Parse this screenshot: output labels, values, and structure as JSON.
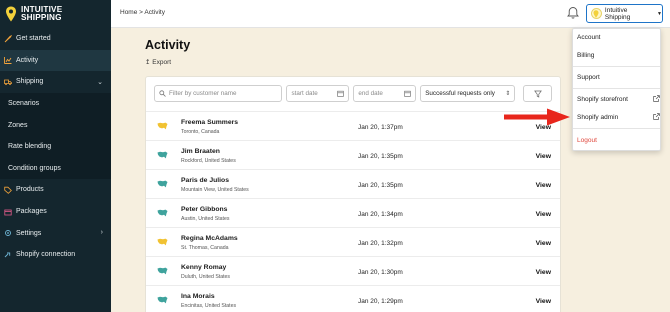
{
  "sidebar": {
    "brand_line1": "INTUITIVE",
    "brand_line2": "SHIPPING",
    "items": [
      {
        "label": "Get started"
      },
      {
        "label": "Activity"
      },
      {
        "label": "Shipping"
      },
      {
        "label": "Scenarios"
      },
      {
        "label": "Zones"
      },
      {
        "label": "Rate blending"
      },
      {
        "label": "Condition groups"
      },
      {
        "label": "Products"
      },
      {
        "label": "Packages"
      },
      {
        "label": "Settings"
      },
      {
        "label": "Shopify connection"
      }
    ]
  },
  "header": {
    "breadcrumb": "Home > Activity",
    "account_label": "Intuitive Shipping"
  },
  "page": {
    "title": "Activity",
    "export_label": "Export"
  },
  "filters": {
    "search_placeholder": "Filter by customer name",
    "start_placeholder": "start date",
    "end_placeholder": "end date",
    "select_value": "Successful requests only"
  },
  "rows": [
    {
      "name": "Freema Summers",
      "location": "Toronto, Canada",
      "date": "Jan 20, 1:37pm",
      "action": "View",
      "country": "CA"
    },
    {
      "name": "Jim Braaten",
      "location": "Rockford, United States",
      "date": "Jan 20, 1:35pm",
      "action": "View",
      "country": "US"
    },
    {
      "name": "Paris de Julios",
      "location": "Mountain View, United States",
      "date": "Jan 20, 1:35pm",
      "action": "View",
      "country": "US"
    },
    {
      "name": "Peter Gibbons",
      "location": "Austin, United States",
      "date": "Jan 20, 1:34pm",
      "action": "View",
      "country": "US"
    },
    {
      "name": "Regina McAdams",
      "location": "St. Thomas, Canada",
      "date": "Jan 20, 1:32pm",
      "action": "View",
      "country": "CA"
    },
    {
      "name": "Kenny Romay",
      "location": "Duluth, United States",
      "date": "Jan 20, 1:30pm",
      "action": "View",
      "country": "US"
    },
    {
      "name": "Ina Morais",
      "location": "Encinitas, United States",
      "date": "Jan 20, 1:29pm",
      "action": "View",
      "country": "US"
    }
  ],
  "menu": {
    "account": "Account",
    "billing": "Billing",
    "support": "Support",
    "shopify_storefront": "Shopify storefront",
    "shopify_admin": "Shopify admin",
    "logout": "Logout"
  },
  "colors": {
    "sidebar_bg": "#14262e",
    "page_bg": "#f6efdf",
    "accent_blue": "#1e74c8",
    "logout_red": "#e0473c",
    "arrow_red": "#e8261c",
    "map_teal": "#3fa39d",
    "map_yellow": "#f1c232"
  }
}
